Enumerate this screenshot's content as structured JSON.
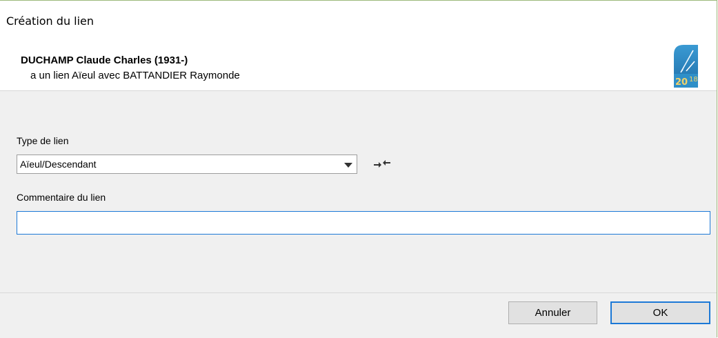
{
  "window": {
    "title": "Création du lien"
  },
  "header": {
    "person_name": "DUCHAMP Claude Charles (1931-)",
    "relation_text": "a un lien Aïeul  avec BATTANDIER Raymonde",
    "logo_year_left": "20",
    "logo_year_right": "18"
  },
  "form": {
    "link_type_label": "Type de lien",
    "link_type_value": "Aïeul/Descendant",
    "comment_label": "Commentaire du lien",
    "comment_value": "",
    "swap_icon": "swap-arrows-icon"
  },
  "buttons": {
    "cancel_label": "Annuler",
    "ok_label": "OK"
  },
  "colors": {
    "accent": "#1b78d6",
    "logo_blue": "#2f8fc8",
    "logo_gold": "#c9a227",
    "panel_bg": "#f0f0f0"
  }
}
